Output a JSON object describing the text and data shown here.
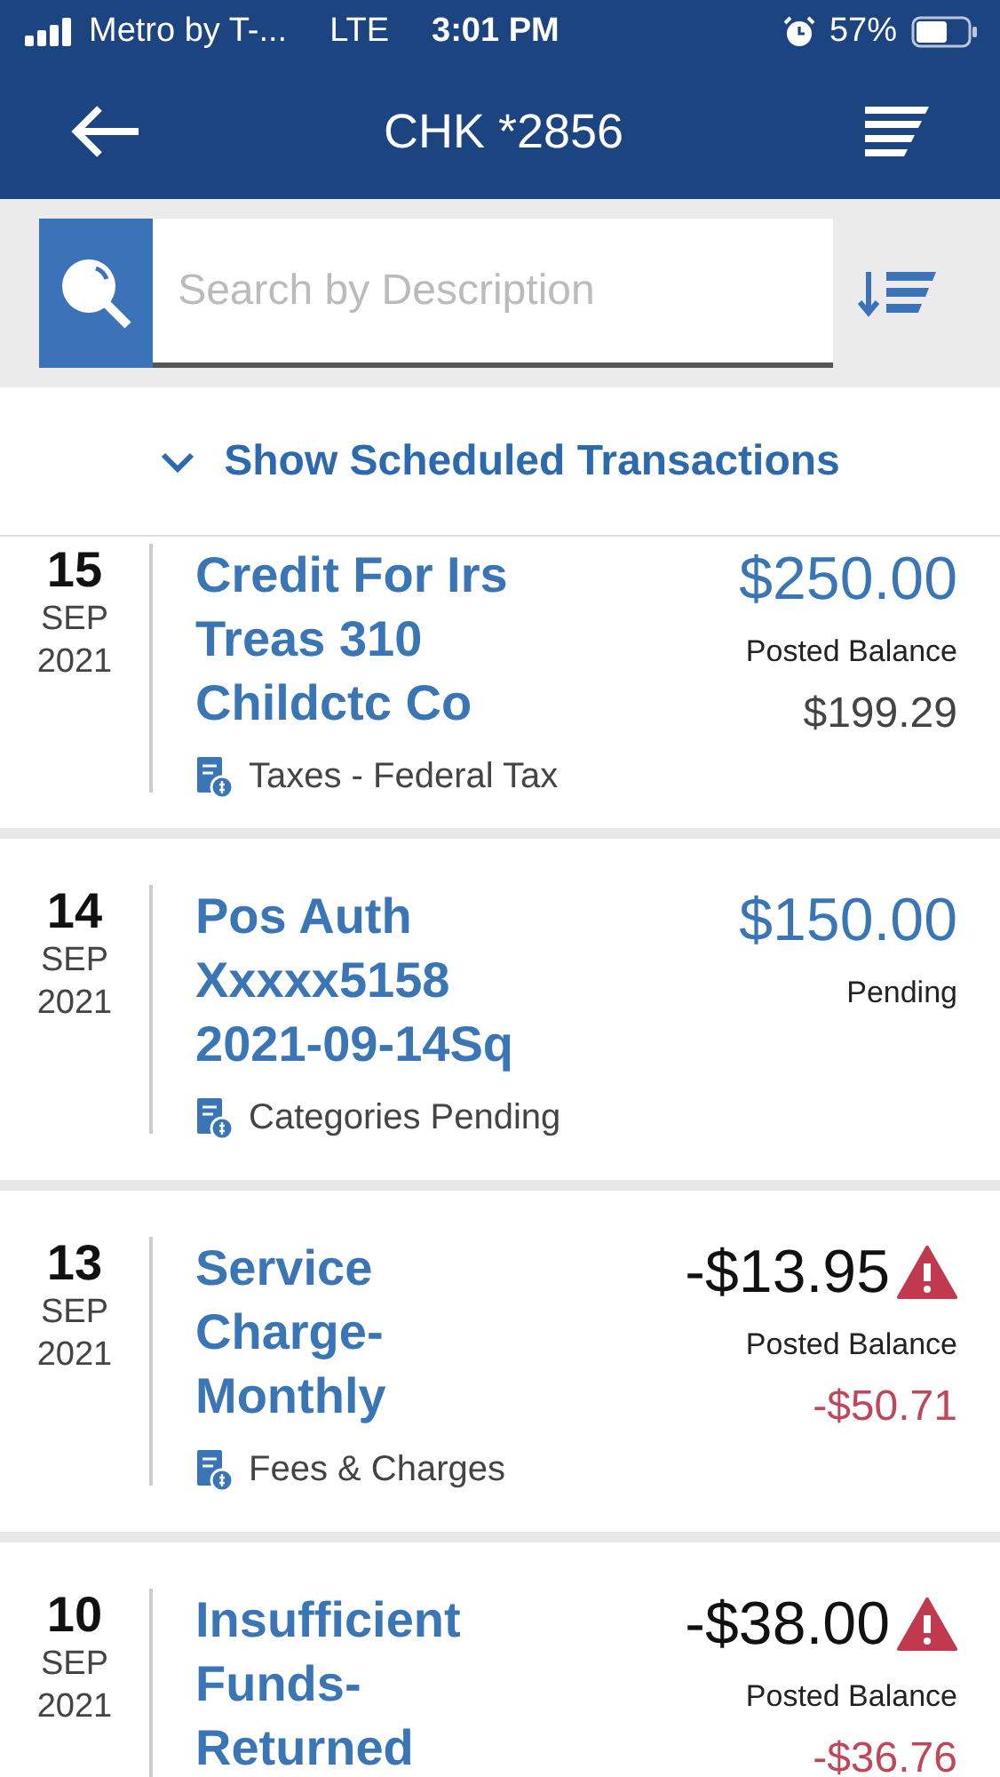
{
  "status_bar": {
    "carrier": "Metro by T-...",
    "network": "LTE",
    "time": "3:01 PM",
    "battery": "57%"
  },
  "header": {
    "title": "CHK *2856"
  },
  "search": {
    "placeholder": "Search by Description"
  },
  "scheduled_toggle": {
    "label": "Show Scheduled Transactions",
    "expanded": false
  },
  "transactions": [
    {
      "day": "15",
      "month": "SEP",
      "year": "2021",
      "description": "Credit For Irs Treas 310 Childctc Co",
      "amount": "$250.00",
      "kind": "credit",
      "alert": false,
      "status": "Posted Balance",
      "balance": "$199.29",
      "category": "Taxes - Federal Tax"
    },
    {
      "day": "14",
      "month": "SEP",
      "year": "2021",
      "description": "Pos Auth Xxxxx5158 2021-09-14Sq",
      "amount": "$150.00",
      "kind": "credit",
      "alert": false,
      "status": "Pending",
      "category": "Categories Pending"
    },
    {
      "day": "13",
      "month": "SEP",
      "year": "2021",
      "description": "Service Charge-Monthly",
      "amount": "-$13.95",
      "kind": "debit",
      "alert": true,
      "status": "Posted Balance",
      "balance": "-$50.71",
      "category": "Fees & Charges"
    },
    {
      "day": "10",
      "month": "SEP",
      "year": "2021",
      "description": "Insufficient Funds-Returned",
      "amount": "-$38.00",
      "kind": "debit",
      "alert": true,
      "status": "Posted Balance",
      "balance": "-$36.76"
    }
  ]
}
